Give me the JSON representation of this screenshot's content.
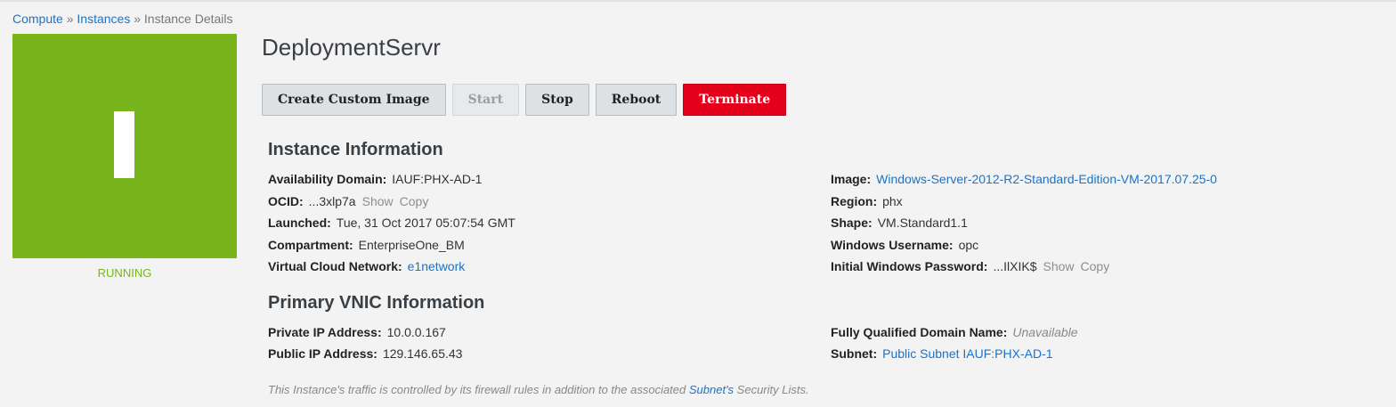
{
  "breadcrumb": {
    "compute": "Compute",
    "sep1": "»",
    "instances": "Instances",
    "sep2": "»",
    "current": "Instance Details"
  },
  "instance": {
    "name": "DeploymentServr",
    "status": "RUNNING",
    "status_color": "#78b51c"
  },
  "actions": {
    "create_image": "Create Custom Image",
    "start": "Start",
    "stop": "Stop",
    "reboot": "Reboot",
    "terminate": "Terminate"
  },
  "instance_info": {
    "heading": "Instance Information",
    "availability_domain": {
      "label": "Availability Domain:",
      "value": "IAUF:PHX-AD-1"
    },
    "ocid": {
      "label": "OCID:",
      "value": "...3xlp7a",
      "show": "Show",
      "copy": "Copy"
    },
    "launched": {
      "label": "Launched:",
      "value": "Tue, 31 Oct 2017 05:07:54 GMT"
    },
    "compartment": {
      "label": "Compartment:",
      "value": "EnterpriseOne_BM"
    },
    "vcn": {
      "label": "Virtual Cloud Network:",
      "value": "e1network"
    },
    "image": {
      "label": "Image:",
      "value": "Windows-Server-2012-R2-Standard-Edition-VM-2017.07.25-0"
    },
    "region": {
      "label": "Region:",
      "value": "phx"
    },
    "shape": {
      "label": "Shape:",
      "value": "VM.Standard1.1"
    },
    "win_user": {
      "label": "Windows Username:",
      "value": "opc"
    },
    "win_pass": {
      "label": "Initial Windows Password:",
      "value": "...IlXIK$",
      "show": "Show",
      "copy": "Copy"
    }
  },
  "vnic_info": {
    "heading": "Primary VNIC Information",
    "private_ip": {
      "label": "Private IP Address:",
      "value": "10.0.0.167"
    },
    "public_ip": {
      "label": "Public IP Address:",
      "value": "129.146.65.43"
    },
    "fqdn": {
      "label": "Fully Qualified Domain Name:",
      "value": "Unavailable"
    },
    "subnet": {
      "label": "Subnet:",
      "value": "Public Subnet IAUF:PHX-AD-1"
    }
  },
  "footnote": {
    "before": "This Instance's traffic is controlled by its firewall rules in addition to the associated ",
    "link": "Subnet's",
    "after": " Security Lists."
  },
  "colors": {
    "accent_link": "#1a73c9",
    "danger": "#e4001a",
    "running": "#78b51c"
  }
}
